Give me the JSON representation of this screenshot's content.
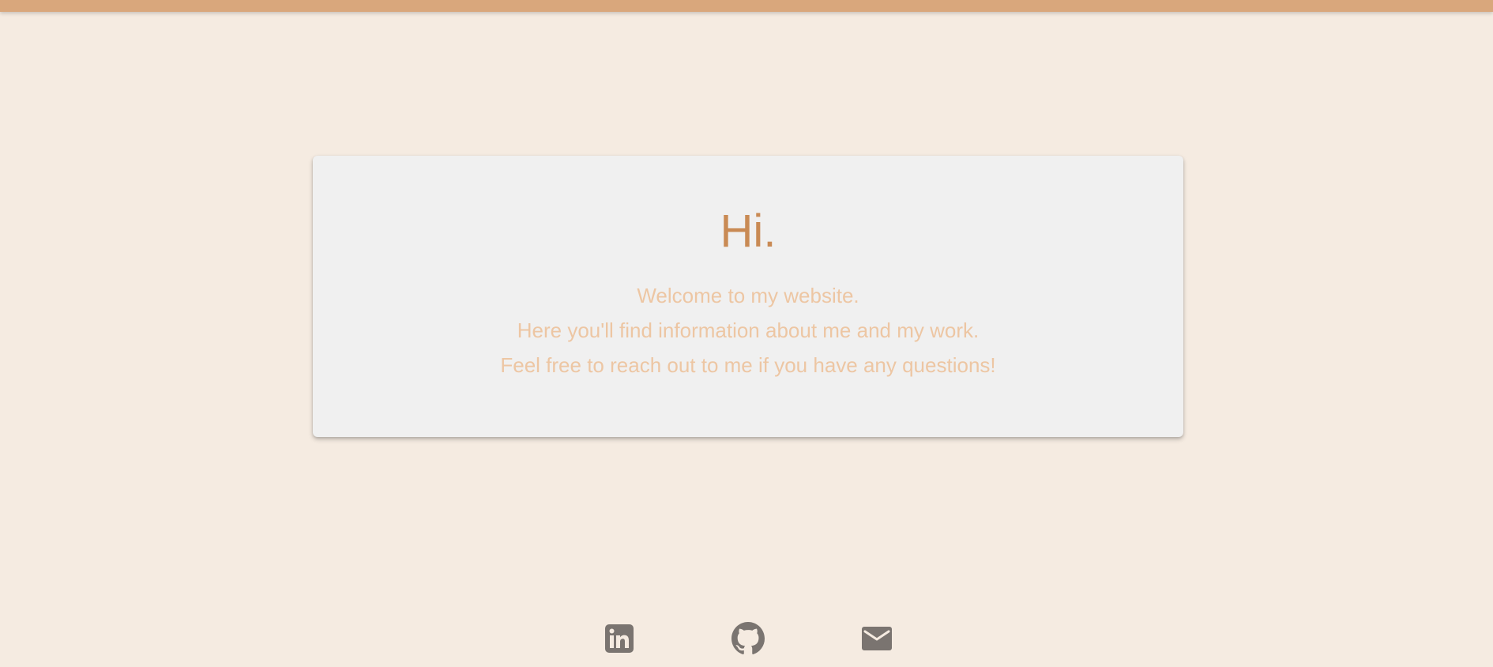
{
  "hero": {
    "greeting": "Hi.",
    "lines": [
      "Welcome to my website.",
      "Here you'll find information about me and my work.",
      "Feel free to reach out to me if you have any questions!"
    ]
  },
  "social_links": [
    {
      "icon": "linkedin-icon"
    },
    {
      "icon": "github-icon"
    },
    {
      "icon": "mail-icon"
    }
  ],
  "colors": {
    "page_background": "#f5ebe1",
    "top_bar": "#d9a77c",
    "card_background": "#f0f0f0",
    "greeting_text": "#c98a54",
    "intro_text": "#edc6a3",
    "icon": "#7a7470"
  }
}
